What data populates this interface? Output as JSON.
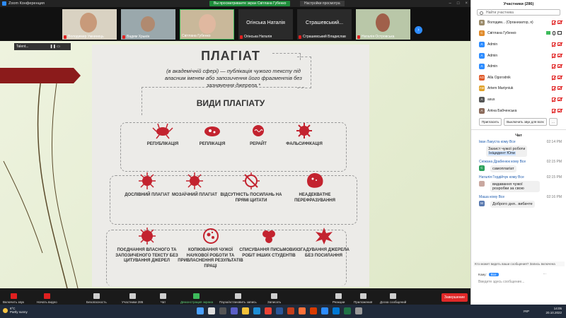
{
  "window": {
    "title": "Zoom Конференция",
    "share_banner": "Вы просматриваете экран Світлана Губенко",
    "view_options": "Настройки просмотра"
  },
  "video_strip": [
    {
      "name": "Володимир Умнинець",
      "muted": true
    },
    {
      "name": "Вадим Хрыкін",
      "muted": true
    },
    {
      "name": "Світлана Губенко",
      "muted": false
    },
    {
      "name": "Огінська Наталія",
      "muted": true,
      "no_video": true
    },
    {
      "name": "Страшевський...",
      "muted": true,
      "no_video": true
    },
    {
      "name": "Наталія Островська",
      "muted": true
    }
  ],
  "video_caps": [
    "Огінська Наталія",
    "Страшевський Владислав"
  ],
  "mini_tile": {
    "label": "Talent..."
  },
  "slide": {
    "title": "ПЛАГІАТ",
    "definition": "(в академічній сфері) — публікація чужого тексту під власним іменем або запозичення його фрагментів без зазначення джерела.*",
    "types_heading": "ВИДИ ПЛАГІАТУ",
    "row1": [
      "РЕПУБЛІКАЦІЯ",
      "РЕПЛІКАЦІЯ",
      "РЕРАЙТ",
      "ФАЛЬСИФІКАЦІЯ"
    ],
    "row2": [
      "ДОСЛІВНИЙ ПЛАГІАТ",
      "МОЗАЇЧНИЙ ПЛАГІАТ",
      "ВІДСУТНІСТЬ ПОСИЛАНЬ НА ПРЯМІ ЦИТАТИ",
      "НЕАДЕКВАТНЕ ПЕРЕФРАЗУВАННЯ"
    ],
    "row3": [
      "ПОЄДНАННЯ ВЛАСНОГО ТА ЗАПОЗИЧЕНОГО ТЕКСТУ БЕЗ ЦИТУВАННЯ ДЖЕРЕЛ",
      "КОПІЮВАННЯ ЧУЖОЇ НАУКОВОЇ РОБОТИ ТА ПРИВЛАСНЕННЯ РЕЗУЛЬТАТІВ ПРАЦІ",
      "СПИСУВАННЯ ПИСЬМОВИХ РОБІТ ІНШИХ СТУДЕНТІВ",
      "ЗГАДУВАННЯ ДЖЕРЕЛА БЕЗ ПОСИЛАННЯ"
    ]
  },
  "toolbar": {
    "items": [
      "Включить звук",
      "Начать видео",
      "Безопасность",
      "Участники",
      "Чат",
      "Демонстрация экрана",
      "Пауза/остановить запись",
      "Записать",
      "Реакции",
      "Приложения",
      "Доска сообщений"
    ],
    "participants_count": "286",
    "chat_count": "1",
    "end": "Завершение"
  },
  "participants": {
    "title": "Участники (286)",
    "search_placeholder": "Найти участника",
    "list": [
      {
        "avatar": "В",
        "name": "Володим... (Организатор, я)",
        "color": "#9a8a6a"
      },
      {
        "avatar": "С",
        "name": "Світлана Губенко",
        "color": "#e08a2a"
      },
      {
        "avatar": "A",
        "name": "Admin",
        "color": "#2d8cff"
      },
      {
        "avatar": "A",
        "name": "Admin",
        "color": "#2d8cff"
      },
      {
        "avatar": "A",
        "name": "Admin",
        "color": "#2d8cff"
      },
      {
        "avatar": "АО",
        "name": "Alla Ogorodnik",
        "color": "#e05a2a"
      },
      {
        "avatar": "AM",
        "name": "Artem Martyniuk",
        "color": "#e0a22a"
      },
      {
        "avatar": "A",
        "name": "asus",
        "color": "#555"
      },
      {
        "avatar": "A",
        "name": "Аліна Бабченська",
        "color": "#8a6a5a"
      }
    ],
    "invite": "Пригласить",
    "mute_all": "Выключить звук для всех"
  },
  "chat": {
    "title": "Чат",
    "messages": [
      {
        "from": "Іван Лакуста",
        "to": "кому Все",
        "time": "02:14 PM",
        "text": "Захист чужої роботи",
        "text2": "Ініцидент Юли",
        "av": "",
        "avc": ""
      },
      {
        "from": "Сніжана Драбенюк",
        "to": "кому Все",
        "time": "02:15 PM",
        "text": "самоплагіат",
        "av": "C",
        "avc": "#2aa05a"
      },
      {
        "from": "Наталія Гордійчук",
        "to": "кому Все",
        "time": "02:15 PM",
        "text": "видавання чужої розробки за свою",
        "av": "",
        "avc": "#c9a8a0"
      },
      {
        "from": "Маша",
        "to": "кому Все",
        "time": "02:16 PM",
        "text": "Доброго дня.. вибачте",
        "av": "M",
        "avc": "#5a7ab0"
      }
    ],
    "notice": "Кто может видеть ваши сообщения? Запись включена",
    "to_label": "Кому:",
    "to_value": "Все",
    "input_placeholder": "Введите здесь сообщение..."
  },
  "taskbar": {
    "temp": "6°C",
    "weather": "Partly sunny",
    "lang": "УКР",
    "time": "14:05",
    "date": "20.10.2022"
  }
}
